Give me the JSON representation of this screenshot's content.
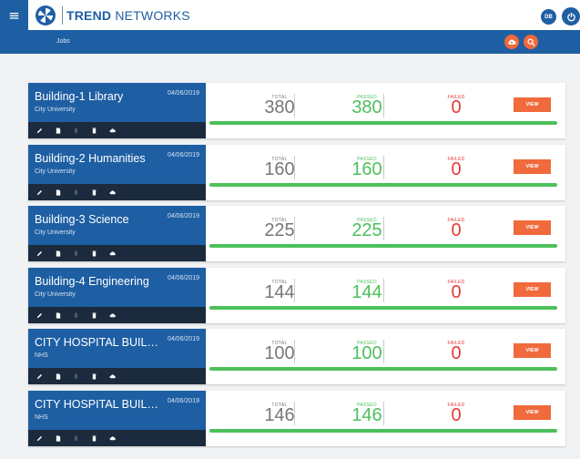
{
  "header": {
    "brand_bold": "TREND",
    "brand_light": "NETWORKS",
    "user_initials": "DB"
  },
  "subbar": {
    "breadcrumb": "Jobs"
  },
  "labels": {
    "total": "TOTAL",
    "passed": "PASSED",
    "failed": "FAILED",
    "view": "VIEW"
  },
  "colors": {
    "primary": "#1e5fa3",
    "accent": "#f06a3c",
    "pass": "#4cc05a",
    "fail": "#e53935",
    "toolbar": "#1b2b3d"
  },
  "icons": [
    "menu-icon",
    "trend-networks-logo",
    "power-icon",
    "cloud-upload-icon",
    "search-icon",
    "pencil-icon",
    "document-icon",
    "paperclip-icon",
    "delete-icon",
    "cloud-icon"
  ],
  "jobs": [
    {
      "name": "Building-1 Library",
      "client": "City University",
      "date": "04/06/2019",
      "total": "380",
      "passed": "380",
      "failed": "0",
      "progress": 1.0
    },
    {
      "name": "Building-2 Humanities",
      "client": "City University",
      "date": "04/06/2019",
      "total": "160",
      "passed": "160",
      "failed": "0",
      "progress": 1.0
    },
    {
      "name": "Building-3 Science",
      "client": "City University",
      "date": "04/06/2019",
      "total": "225",
      "passed": "225",
      "failed": "0",
      "progress": 1.0
    },
    {
      "name": "Building-4 Engineering",
      "client": "City University",
      "date": "04/06/2019",
      "total": "144",
      "passed": "144",
      "failed": "0",
      "progress": 1.0
    },
    {
      "name": "CITY HOSPITAL BUILDI...",
      "client": "NHS",
      "date": "04/06/2019",
      "total": "100",
      "passed": "100",
      "failed": "0",
      "progress": 1.0
    },
    {
      "name": "CITY HOSPITAL BUILDI...",
      "client": "NHS",
      "date": "04/06/2019",
      "total": "146",
      "passed": "146",
      "failed": "0",
      "progress": 1.0
    }
  ]
}
